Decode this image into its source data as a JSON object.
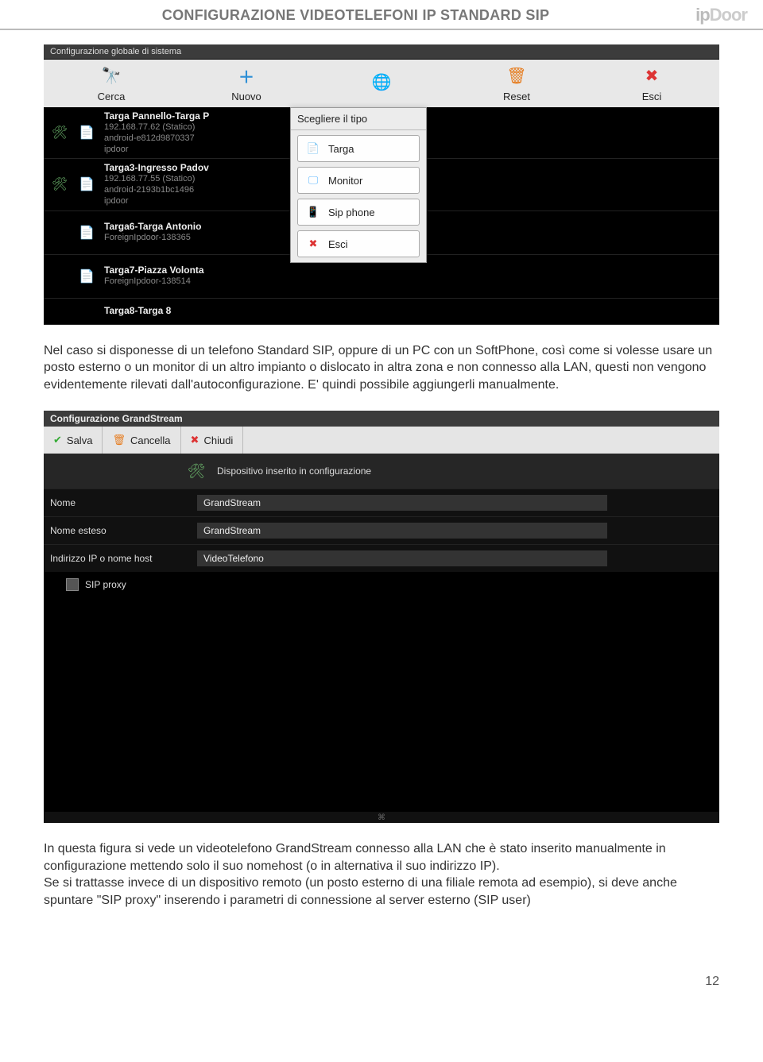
{
  "header": {
    "title": "CONFIGURAZIONE VIDEOTELEFONI IP STANDARD SIP",
    "brand": "ipDoor"
  },
  "screenshot1": {
    "window_title": "Configurazione globale di sistema",
    "toolbar": [
      {
        "label": "Cerca"
      },
      {
        "label": "Nuovo"
      },
      {
        "label": ""
      },
      {
        "label": "Reset"
      },
      {
        "label": "Esci"
      }
    ],
    "devices": [
      {
        "title": "Targa Pannello-Targa P",
        "line2": "192.168.77.62 (Statico)",
        "line3": "android-e812d9870337",
        "line4": "ipdoor",
        "show_cfg": true
      },
      {
        "title": "Targa3-Ingresso Padov",
        "line2": "192.168.77.55 (Statico)",
        "line3": "android-2193b1bc1496",
        "line4": "ipdoor",
        "show_cfg": true
      },
      {
        "title": "Targa6-Targa Antonio",
        "line2": "",
        "line3": "ForeignIpdoor-138365",
        "line4": "",
        "show_cfg": false
      },
      {
        "title": "Targa7-Piazza Volonta",
        "line2": "",
        "line3": "ForeignIpdoor-138514",
        "line4": "",
        "show_cfg": false
      },
      {
        "title": "Targa8-Targa 8",
        "line2": "",
        "line3": "",
        "line4": "",
        "show_cfg": false
      }
    ],
    "popup": {
      "title": "Scegliere il tipo",
      "options": [
        "Targa",
        "Monitor",
        "Sip phone",
        "Esci"
      ]
    }
  },
  "paragraph1": "Nel caso si disponesse di un telefono Standard SIP,  oppure di un PC con un SoftPhone, così come si volesse usare un posto esterno o un monitor di un altro impianto o dislocato in altra zona e non connesso alla LAN, questi non vengono evidentemente rilevati dall'autoconfigurazione. E' quindi possibile aggiungerli manualmente.",
  "screenshot2": {
    "window_title": "Configurazione GrandStream",
    "toolbar": [
      {
        "label": "Salva"
      },
      {
        "label": "Cancella"
      },
      {
        "label": "Chiudi"
      }
    ],
    "cfg_header": "Dispositivo inserito in configurazione",
    "fields": [
      {
        "label": "Nome",
        "value": "GrandStream"
      },
      {
        "label": "Nome esteso",
        "value": "GrandStream"
      },
      {
        "label": "Indirizzo IP o nome host",
        "value": "VideoTelefono"
      }
    ],
    "checkbox": {
      "label": "SIP proxy"
    }
  },
  "paragraph2": "In questa figura si vede un videotelefono GrandStream connesso alla LAN che è stato inserito manualmente in configurazione mettendo solo il suo nomehost (o in alternativa il suo indirizzo IP).\nSe si trattasse invece di un dispositivo remoto (un posto esterno di una filiale remota ad esempio), si deve anche spuntare \"SIP proxy\" inserendo i parametri di connessione al server esterno (SIP user)",
  "page_number": "12"
}
